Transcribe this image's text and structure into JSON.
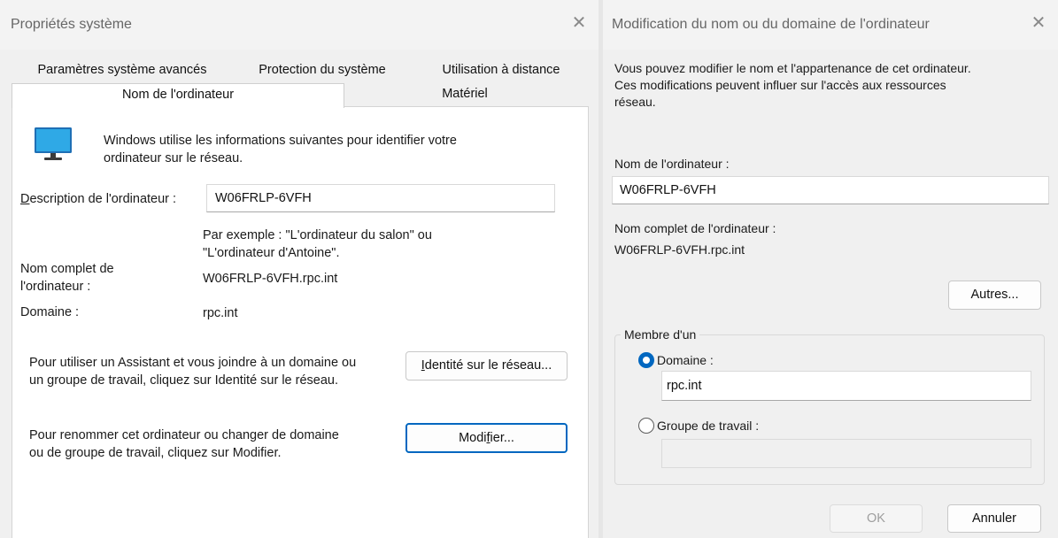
{
  "left_window": {
    "title": "Propriétés système",
    "close_glyph": "✕",
    "tabs_row1": [
      "Paramètres système avancés",
      "Protection du système",
      "Utilisation à distance"
    ],
    "tabs_row2": [
      "Nom de l'ordinateur",
      "Matériel"
    ],
    "selected_tab": "Nom de l'ordinateur",
    "icon": "monitor-icon",
    "intro_line1": "Windows utilise les informations suivantes pour identifier votre",
    "intro_line2": "ordinateur sur le réseau.",
    "description_label_first": "D",
    "description_label_rest": "escription de l'ordinateur :",
    "description_value": "W06FRLP-6VFH",
    "example_line1": "Par exemple : \"L'ordinateur du salon\" ou",
    "example_line2": "\"L'ordinateur d'Antoine\".",
    "fullname_label_line1": "Nom complet de",
    "fullname_label_line2": "l'ordinateur :",
    "fullname_value": "W06FRLP-6VFH.rpc.int",
    "domain_label": "Domaine :",
    "domain_value": "rpc.int",
    "network_text_line1": "Pour utiliser un Assistant et vous joindre à un domaine ou",
    "network_text_line2": "un groupe de travail, cliquez sur Identité sur le réseau.",
    "network_button_first": "I",
    "network_button_rest": "dentité sur le réseau...",
    "rename_text_line1": "Pour renommer cet ordinateur ou changer de domaine",
    "rename_text_line2": "ou de groupe de travail, cliquez sur Modifier.",
    "modify_button_pre": "Modi",
    "modify_button_u": "f",
    "modify_button_post": "ier..."
  },
  "right_window": {
    "title": "Modification du nom ou du domaine de l'ordinateur",
    "close_glyph": "✕",
    "intro_line1": "Vous pouvez modifier le nom et l'appartenance de cet ordinateur.",
    "intro_line2": "Ces modifications peuvent influer sur l'accès aux ressources",
    "intro_line3": "réseau.",
    "computer_name_label": "Nom de l'ordinateur :",
    "computer_name_value": "W06FRLP-6VFH",
    "fullname_label": "Nom complet de l'ordinateur :",
    "fullname_value": "W06FRLP-6VFH.rpc.int",
    "more_button": "Autres...",
    "member_of_label": "Membre d'un",
    "domain_radio_label": "Domaine :",
    "domain_selected": true,
    "domain_value": "rpc.int",
    "workgroup_radio_label": "Groupe de travail :",
    "workgroup_value": "",
    "ok_button": "OK",
    "ok_enabled": false,
    "cancel_button": "Annuler"
  },
  "colors": {
    "accent": "#0067c0",
    "window_bg": "#f0f0f0",
    "panel_bg": "#ffffff"
  }
}
